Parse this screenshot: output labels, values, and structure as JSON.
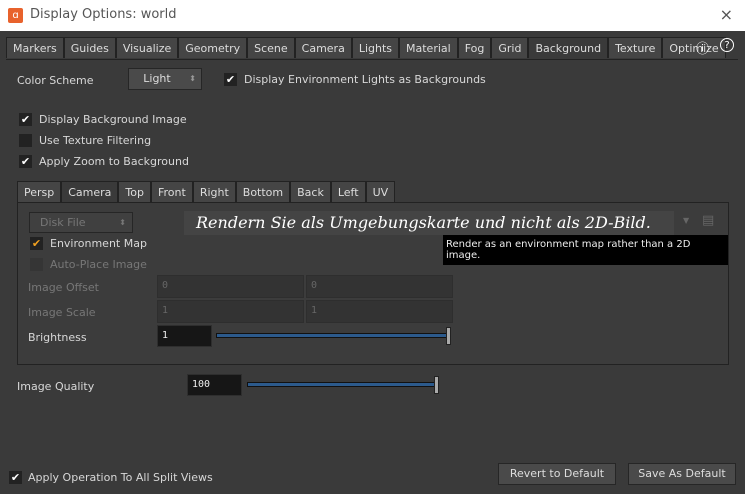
{
  "window": {
    "title": "Display Options:  world",
    "logo": "houdini-logo",
    "close": "×"
  },
  "tabs": [
    "Markers",
    "Guides",
    "Visualize",
    "Geometry",
    "Scene",
    "Camera",
    "Lights",
    "Material",
    "Fog",
    "Grid",
    "Background",
    "Texture",
    "Optimize"
  ],
  "selected_tab": "Background",
  "header_icons": {
    "info": "ⓘ",
    "help": "?"
  },
  "color_scheme": {
    "label": "Color Scheme",
    "value": "Light"
  },
  "env_lights": {
    "label": "Display Environment Lights as Backgrounds",
    "checked": true
  },
  "options": [
    {
      "label": "Display Background Image",
      "checked": true
    },
    {
      "label": "Use Texture Filtering",
      "checked": false
    },
    {
      "label": "Apply Zoom to Background",
      "checked": true
    }
  ],
  "view_tabs": [
    "Persp",
    "Camera",
    "Top",
    "Front",
    "Right",
    "Bottom",
    "Back",
    "Left",
    "UV"
  ],
  "selected_view_tab": "Camera",
  "source": {
    "value": "Disk File"
  },
  "file_overlay_text": "Rendern Sie als Umgebungskarte und nicht als 2D-Bild.",
  "env_map": {
    "label": "Environment Map",
    "checked": true
  },
  "tooltip": "Render as an environment map rather than a 2D image.",
  "auto_place": {
    "label": "Auto-Place Image",
    "checked": false
  },
  "image_offset": {
    "label": "Image Offset",
    "x": "0",
    "y": "0"
  },
  "image_scale": {
    "label": "Image Scale",
    "x": "1",
    "y": "1"
  },
  "brightness": {
    "label": "Brightness",
    "value": "1",
    "slider_fraction": 1.0
  },
  "image_quality": {
    "label": "Image Quality",
    "value": "100",
    "slider_fraction": 1.0
  },
  "footer": {
    "apply_all": {
      "label": "Apply Operation To All Split Views",
      "checked": true
    },
    "revert": "Revert to Default",
    "save": "Save As Default"
  }
}
